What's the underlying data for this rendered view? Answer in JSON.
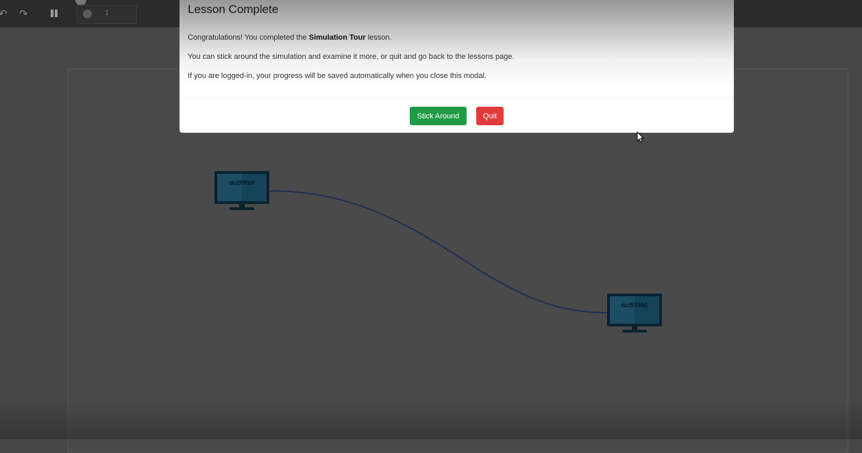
{
  "toolbar": {
    "undo_icon": "undo-icon",
    "redo_icon": "redo-icon",
    "pause_icon": "pause-icon",
    "speed_icon": "gauge-icon",
    "speed_value": "1"
  },
  "devices": [
    {
      "label": "dc2f9fa0"
    },
    {
      "label": "dcf53990"
    }
  ],
  "modal": {
    "title": "Lesson Complete",
    "para1_before": "Congratulations! You completed the ",
    "para1_bold": "Simulation Tour",
    "para1_after": " lesson.",
    "para2": "You can stick around the simulation and examine it more, or quit and go back to the lessons page.",
    "para3": "If you are logged-in, your progress will be saved automatically when you close this modal.",
    "stick_around_label": "Stick Around",
    "quit_label": "Quit"
  },
  "colors": {
    "success": "#1f9a45",
    "danger": "#e23a3a",
    "link": "#1e2f55",
    "device": "#0d2f3f"
  }
}
